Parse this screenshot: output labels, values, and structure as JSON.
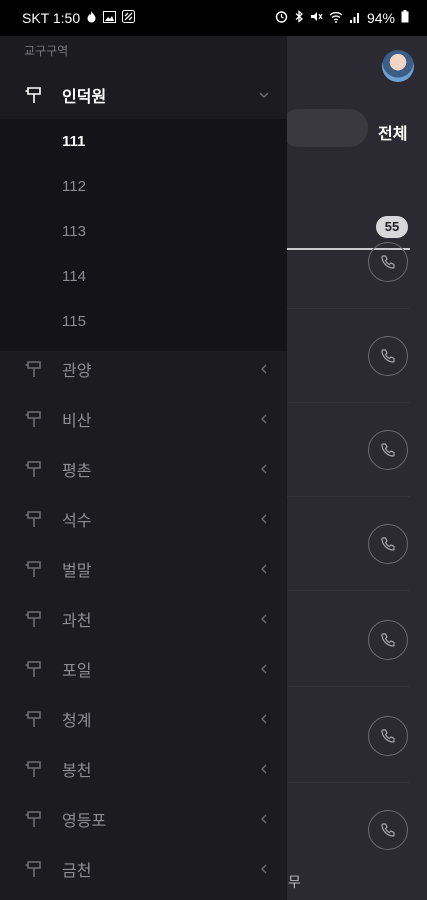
{
  "status_bar": {
    "carrier_time": "SKT 1:50",
    "battery": "94%",
    "left_icons": [
      "fire-icon",
      "image-icon",
      "app-icon"
    ],
    "right_icons": [
      "alarm-icon",
      "bluetooth-icon",
      "mute-icon",
      "wifi-icon",
      "signal-icon",
      "battery-icon"
    ]
  },
  "drawer": {
    "section_title": "교구구역",
    "expanded_group": {
      "label": "인덕원",
      "sub_items": [
        "111",
        "112",
        "113",
        "114",
        "115"
      ],
      "active_sub": "111"
    },
    "groups": [
      {
        "label": "관양"
      },
      {
        "label": "비산"
      },
      {
        "label": "평촌"
      },
      {
        "label": "석수"
      },
      {
        "label": "벌말"
      },
      {
        "label": "과천"
      },
      {
        "label": "포일"
      },
      {
        "label": "청계"
      },
      {
        "label": "봉천"
      },
      {
        "label": "영등포"
      },
      {
        "label": "금천"
      }
    ]
  },
  "background": {
    "all_tab": "전체",
    "count_badge": "55",
    "snippet": "무"
  },
  "colors": {
    "drawer_bg": "#1c1b20",
    "expanded_bg": "#141317",
    "main_bg": "#2b2a32"
  }
}
